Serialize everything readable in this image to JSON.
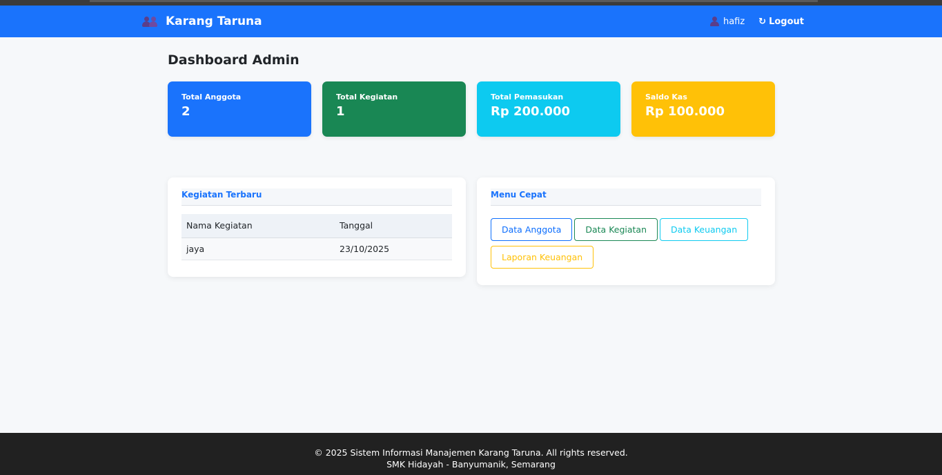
{
  "navbar": {
    "brand": "Karang Taruna",
    "brand_icon": "users-icon",
    "user_name": "hafiz",
    "user_icon": "user-icon",
    "logout_label": "Logout",
    "logout_icon": "logout-icon",
    "bg_color": "#1a73fc"
  },
  "page": {
    "title": "Dashboard Admin"
  },
  "cards": [
    {
      "label": "Total Anggota",
      "value": "2",
      "color": "#1a73fc"
    },
    {
      "label": "Total Kegiatan",
      "value": "1",
      "color": "#198754"
    },
    {
      "label": "Total Pemasukan",
      "value": "Rp 200.000",
      "color": "#0dcaf0"
    },
    {
      "label": "Saldo Kas",
      "value": "Rp 100.000",
      "color": "#ffc107"
    }
  ],
  "recent": {
    "title": "Kegiatan Terbaru",
    "columns": [
      "Nama Kegiatan",
      "Tanggal"
    ],
    "rows": [
      [
        "jaya",
        "23/10/2025"
      ]
    ]
  },
  "quick_menu": {
    "title": "Menu Cepat",
    "buttons": [
      {
        "label": "Data Anggota",
        "color": "#0d6efd"
      },
      {
        "label": "Data Kegiatan",
        "color": "#198754"
      },
      {
        "label": "Data Keuangan",
        "color": "#0dcaf0"
      },
      {
        "label": "Laporan Keuangan",
        "color": "#ffc107"
      }
    ]
  },
  "footer": {
    "line1": "© 2025 Sistem Informasi Manajemen Karang Taruna. All rights reserved.",
    "line2": "SMK Hidayah - Banyumanik, Semarang"
  }
}
